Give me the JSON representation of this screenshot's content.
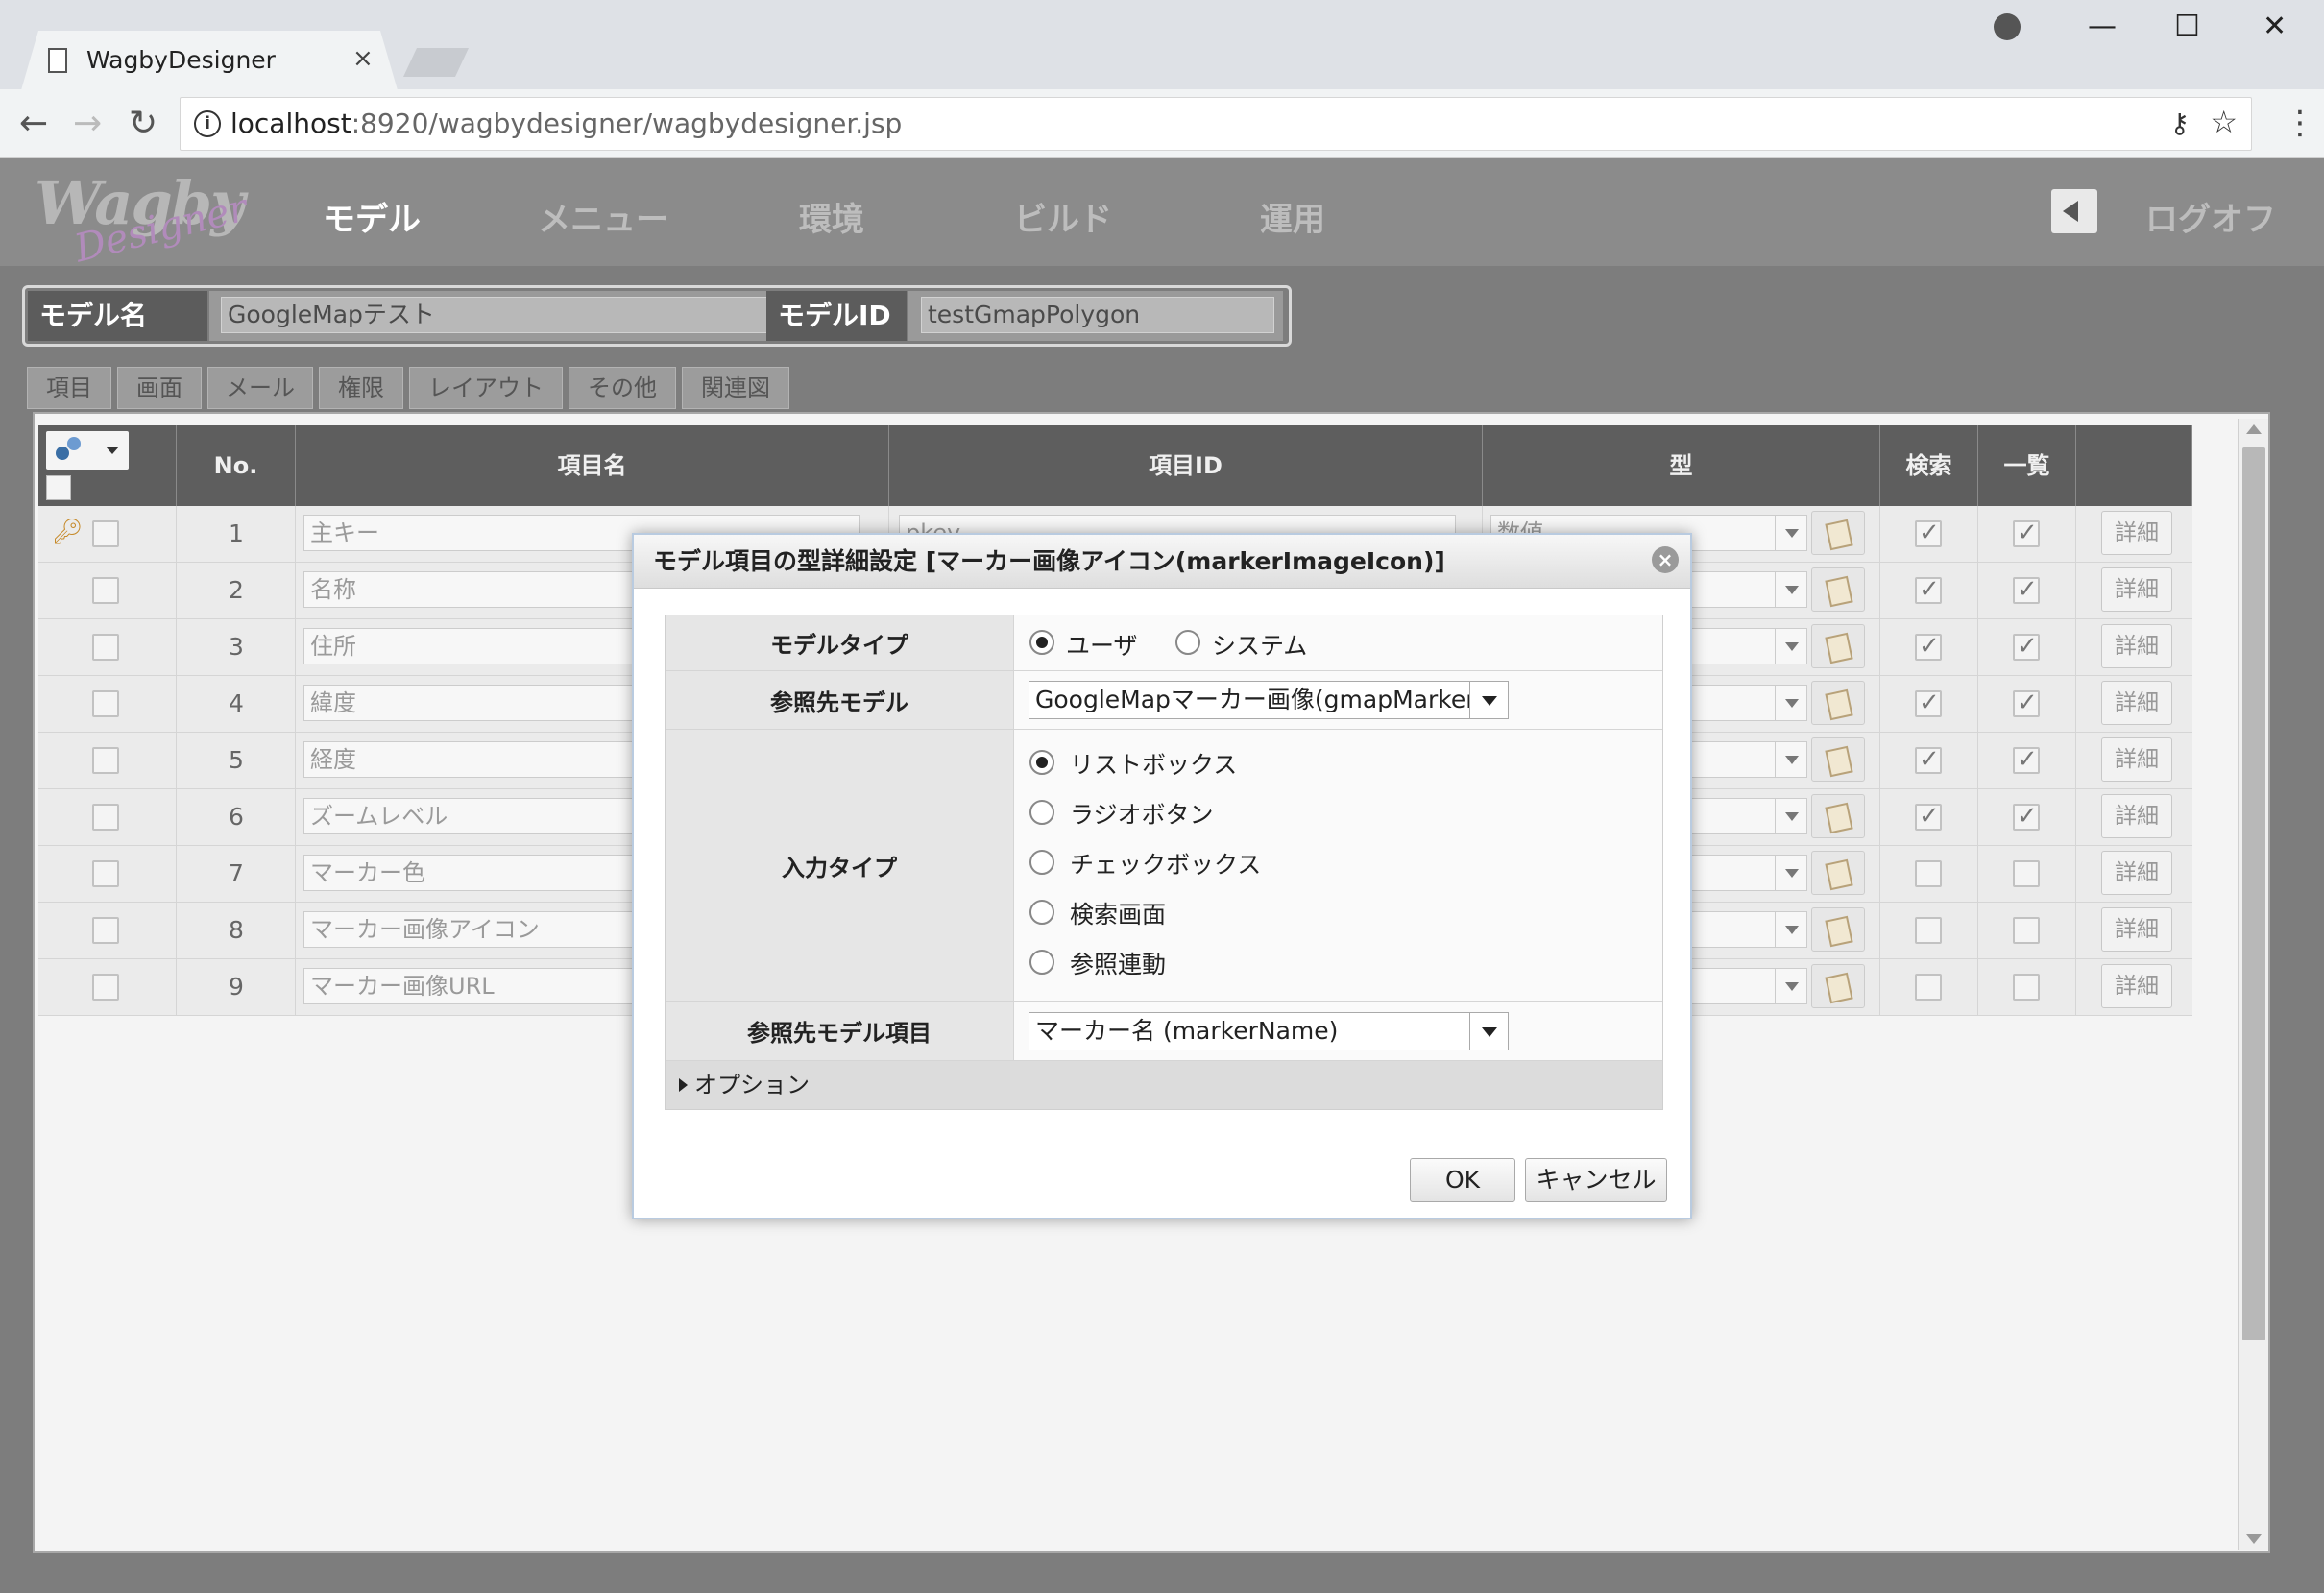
{
  "browser": {
    "tab_title": "WagbyDesigner",
    "tab_close": "×",
    "url_host": "localhost",
    "url_rest": ":8920/wagbydesigner/wagbydesigner.jsp",
    "back": "←",
    "forward": "→",
    "reload": "↻",
    "minimize": "—",
    "maximize": "☐",
    "close": "✕",
    "menu": "⋮"
  },
  "app": {
    "logo_top": "Wagby",
    "logo_script": "Designer",
    "nav": [
      "モデル",
      "メニュー",
      "環境",
      "ビルド",
      "運用"
    ],
    "logoff": "ログオフ"
  },
  "model": {
    "name_label": "モデル名",
    "name_value": "GoogleMapテスト",
    "id_label": "モデルID",
    "id_value": "testGmapPolygon"
  },
  "subtabs": [
    "項目",
    "画面",
    "メール",
    "権限",
    "レイアウト",
    "その他",
    "関連図"
  ],
  "grid": {
    "headers": {
      "no": "No.",
      "name": "項目名",
      "id": "項目ID",
      "type": "型",
      "search": "検索",
      "list": "一覧"
    },
    "detail_label": "詳細",
    "rows": [
      {
        "no": "1",
        "name": "主キー",
        "id": "pkey",
        "type": "数値",
        "search": true,
        "list": true,
        "key": true
      },
      {
        "no": "2",
        "name": "名称",
        "id": "",
        "type": "",
        "search": true,
        "list": true,
        "key": false
      },
      {
        "no": "3",
        "name": "住所",
        "id": "",
        "type": "",
        "search": true,
        "list": true,
        "key": false
      },
      {
        "no": "4",
        "name": "緯度",
        "id": "",
        "type": "",
        "search": true,
        "list": true,
        "key": false
      },
      {
        "no": "5",
        "name": "経度",
        "id": "",
        "type": "",
        "search": true,
        "list": true,
        "key": false
      },
      {
        "no": "6",
        "name": "ズームレベル",
        "id": "",
        "type": "",
        "search": true,
        "list": true,
        "key": false
      },
      {
        "no": "7",
        "name": "マーカー色",
        "id": "",
        "type": "",
        "search": false,
        "list": false,
        "key": false
      },
      {
        "no": "8",
        "name": "マーカー画像アイコン",
        "id": "",
        "type": "",
        "search": false,
        "list": false,
        "key": false
      },
      {
        "no": "9",
        "name": "マーカー画像URL",
        "id": "",
        "type": "",
        "search": false,
        "list": false,
        "key": false
      }
    ]
  },
  "dialog": {
    "title": "モデル項目の型詳細設定 [マーカー画像アイコン(markerImageIcon)]",
    "close": "×",
    "model_type_label": "モデルタイプ",
    "model_type_options": [
      "ユーザ",
      "システム"
    ],
    "model_type_selected": "ユーザ",
    "ref_model_label": "参照先モデル",
    "ref_model_value": "GoogleMapマーカー画像(gmapMarkerImage)",
    "input_type_label": "入力タイプ",
    "input_type_options": [
      "リストボックス",
      "ラジオボタン",
      "チェックボックス",
      "検索画面",
      "参照連動"
    ],
    "input_type_selected": "リストボックス",
    "ref_item_label": "参照先モデル項目",
    "ref_item_value": "マーカー名 (markerName)",
    "options_label": "オプション",
    "ok": "OK",
    "cancel": "キャンセル"
  }
}
